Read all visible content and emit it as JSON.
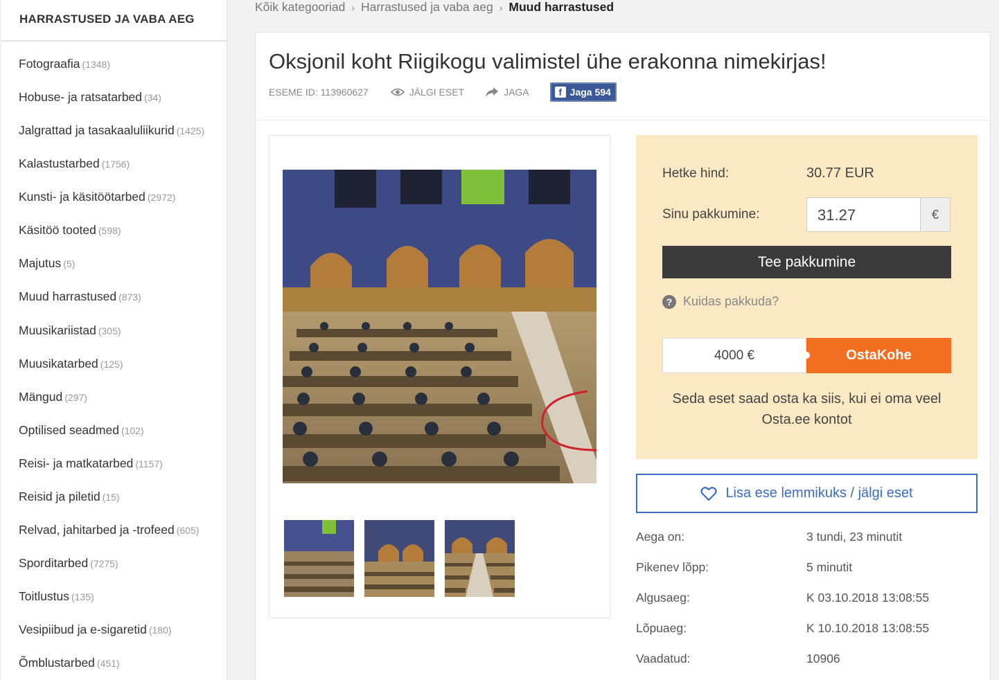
{
  "sidebar": {
    "heading": "HARRASTUSED JA VABA AEG",
    "items": [
      {
        "label": "Fotograafia",
        "count": "(1348)"
      },
      {
        "label": "Hobuse- ja ratsatarbed",
        "count": "(34)"
      },
      {
        "label": "Jalgrattad ja tasakaaluliikurid",
        "count": "(1425)"
      },
      {
        "label": "Kalastustarbed",
        "count": "(1756)"
      },
      {
        "label": "Kunsti- ja käsitöötarbed",
        "count": "(2972)"
      },
      {
        "label": "Käsitöö tooted",
        "count": "(598)"
      },
      {
        "label": "Majutus",
        "count": "(5)"
      },
      {
        "label": "Muud harrastused",
        "count": "(873)"
      },
      {
        "label": "Muusikariistad",
        "count": "(305)"
      },
      {
        "label": "Muusikatarbed",
        "count": "(125)"
      },
      {
        "label": "Mängud",
        "count": "(297)"
      },
      {
        "label": "Optilised seadmed",
        "count": "(102)"
      },
      {
        "label": "Reisi- ja matkatarbed",
        "count": "(1157)"
      },
      {
        "label": "Reisid ja piletid",
        "count": "(15)"
      },
      {
        "label": "Relvad, jahitarbed ja -trofeed",
        "count": "(605)"
      },
      {
        "label": "Spordi­tarbed",
        "count": "(7275)"
      },
      {
        "label": "Toitlustus",
        "count": "(135)"
      },
      {
        "label": "Vesipiibud ja e-sigaretid",
        "count": "(180)"
      },
      {
        "label": "Õmblustarbed",
        "count": "(451)"
      }
    ]
  },
  "breadcrumb": {
    "items": [
      "Kõik kategooriad",
      "Harrastused ja vaba aeg"
    ],
    "separator": "›",
    "current": "Muud harrastused"
  },
  "item": {
    "title": "Oksjonil koht Riigikogu valimistel ühe erakonna nimekirjas!",
    "id_text": "ESEME ID: 113960627",
    "watch_label": "JÄLGI ESET",
    "share_label": "JAGA",
    "fb_label": "Jaga 594",
    "fb_icon": "f"
  },
  "bid": {
    "current_label": "Hetke hind:",
    "current_value": "30.77 EUR",
    "your_label": "Sinu pakkumine:",
    "your_value": "31.27",
    "currency": "€",
    "submit_label": "Tee pakkumine",
    "help_icon": "?",
    "help_label": "Kuidas pakkuda?",
    "buynow_price": "4000 €",
    "buynow_label": "OstaKohe",
    "note": "Seda eset saad osta ka siis, kui ei oma veel Osta.ee kontot",
    "accent_color": "#f26f22"
  },
  "watch_button": {
    "label": "Lisa ese lemmikuks / jälgi eset",
    "icon": "heart-icon",
    "color": "#3c6cc6"
  },
  "details": [
    {
      "label": "Aega on:",
      "value": "3 tundi, 23 minutit"
    },
    {
      "label": "Pikenev lõpp:",
      "value": "5 minutit"
    },
    {
      "label": "Algusaeg:",
      "value": "K 03.10.2018 13:08:55"
    },
    {
      "label": "Lõpuaeg:",
      "value": "K 10.10.2018 13:08:55"
    },
    {
      "label": "Vaadatud:",
      "value": "10906"
    }
  ]
}
